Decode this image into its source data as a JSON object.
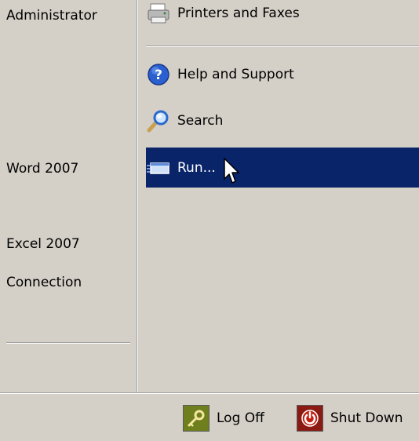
{
  "left_pane": {
    "items": [
      {
        "label": "Administrator"
      },
      {
        "label": "Word 2007"
      },
      {
        "label": "Excel 2007"
      },
      {
        "label": " Connection"
      }
    ]
  },
  "right_pane": {
    "items": [
      {
        "label": "Printers and Faxes",
        "icon": "printer-icon"
      },
      {
        "label": "Help and Support",
        "icon": "help-icon"
      },
      {
        "label": "Search",
        "icon": "search-icon"
      },
      {
        "label": "Run...",
        "icon": "run-icon",
        "selected": true
      }
    ]
  },
  "bottom_bar": {
    "log_off_label": "Log Off",
    "shut_down_label": "Shut Down"
  },
  "colors": {
    "background": "#d4d0c8",
    "selection": "#0a246a",
    "log_off": "#6f7f1e",
    "shut_down": "#8a1a12"
  }
}
